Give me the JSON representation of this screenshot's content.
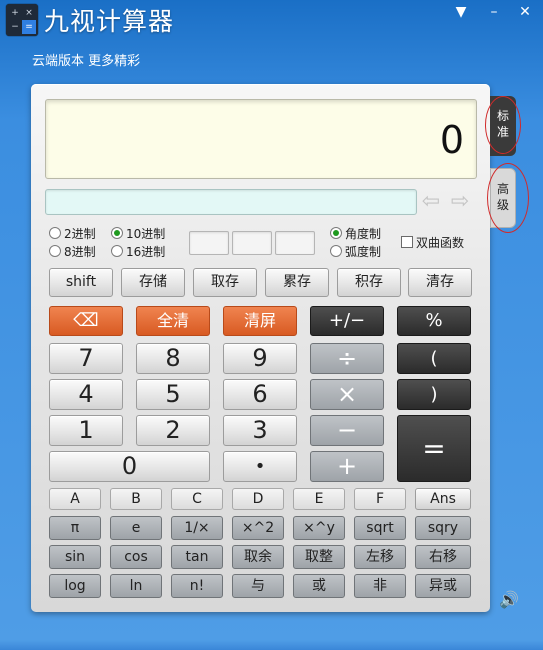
{
  "window": {
    "title": "九视计算器",
    "subtitle": "云端版本 更多精彩",
    "icon_glyphs": [
      "+",
      "×",
      "−",
      "="
    ],
    "controls": {
      "dropdown": "▼",
      "minimize": "–",
      "close": "✕"
    }
  },
  "display": {
    "value": "0",
    "expression": ""
  },
  "arrows": {
    "left": "⇦",
    "right": "⇨"
  },
  "base": {
    "bin": "2进制",
    "dec": "10进制",
    "oct": "8进制",
    "hex": "16进制",
    "selected": "10进制"
  },
  "angle": {
    "deg": "角度制",
    "rad": "弧度制",
    "selected": "角度制"
  },
  "hyperbolic": {
    "label": "双曲函数",
    "checked": false
  },
  "memory_buttons": [
    "shift",
    "存储",
    "取存",
    "累存",
    "积存",
    "清存"
  ],
  "row_main": [
    "⌫",
    "全清",
    "清屏",
    "+/−",
    "%"
  ],
  "keypad": {
    "digits": [
      "7",
      "8",
      "9",
      "4",
      "5",
      "6",
      "1",
      "2",
      "3",
      "0",
      "•"
    ],
    "ops": [
      "÷",
      "×",
      "−",
      "+"
    ],
    "paren_open": "(",
    "paren_close": ")",
    "equals": "="
  },
  "hex_buttons": [
    "A",
    "B",
    "C",
    "D",
    "E",
    "F",
    "Ans"
  ],
  "sci_rows": [
    [
      "π",
      "e",
      "1/×",
      "×^2",
      "×^y",
      "sqrt",
      "sqry"
    ],
    [
      "sin",
      "cos",
      "tan",
      "取余",
      "取整",
      "左移",
      "右移"
    ],
    [
      "log",
      "ln",
      "n!",
      "与",
      "或",
      "非",
      "异或"
    ]
  ],
  "tabs": {
    "standard": "标准",
    "advanced": "高级"
  },
  "volume_icon": "🔊",
  "colors": {
    "accent_orange": "#e06a30",
    "display_bg": "#fdfde8",
    "window_blue": "#3b8ee0"
  }
}
